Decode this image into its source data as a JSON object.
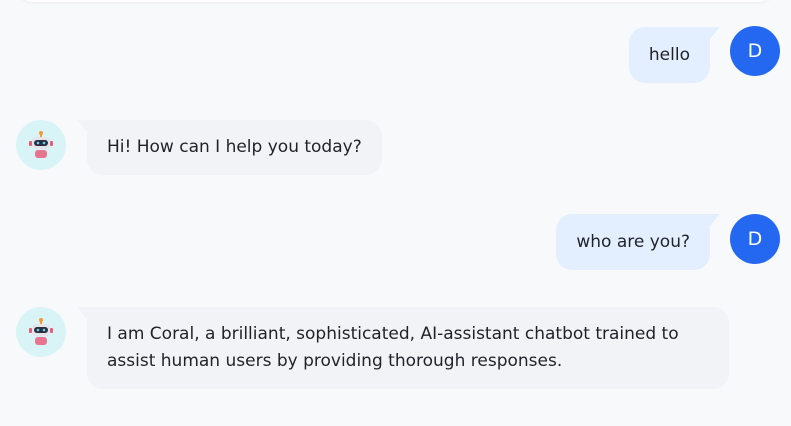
{
  "colors": {
    "background": "#f8f9fb",
    "user_avatar": "#2468f2",
    "user_bubble": "#e3efff",
    "bot_avatar_bg": "#d9f4f6",
    "bot_bubble": "#f1f3f6"
  },
  "user": {
    "avatar_letter": "D"
  },
  "bot": {
    "avatar_icon": "robot-icon"
  },
  "messages": [
    {
      "role": "user",
      "text": "hello"
    },
    {
      "role": "assistant",
      "text": "Hi! How can I help you today?"
    },
    {
      "role": "user",
      "text": "who are you?"
    },
    {
      "role": "assistant",
      "text": "I am Coral, a brilliant, sophisticated, AI-assistant chatbot trained to assist human users by providing thorough responses."
    }
  ]
}
